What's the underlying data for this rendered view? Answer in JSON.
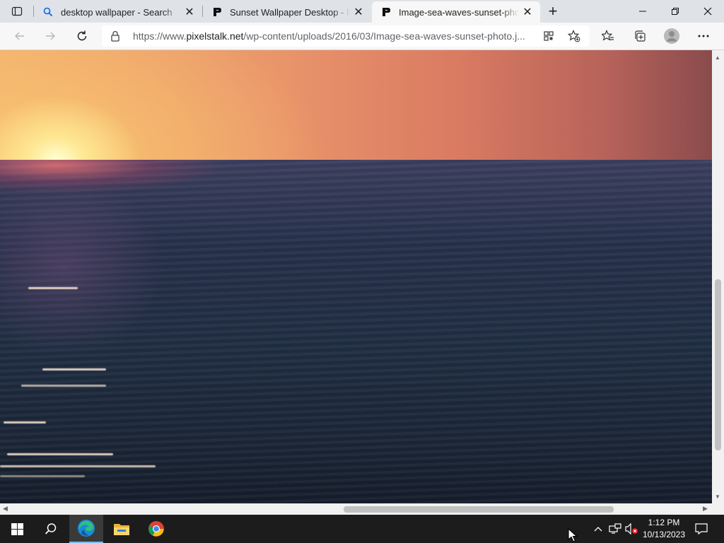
{
  "browser": {
    "tabs": [
      {
        "title": "desktop wallpaper - Search",
        "favicon": "search-icon",
        "active": false
      },
      {
        "title": "Sunset Wallpaper Desktop - Pixe",
        "favicon": "pixelstalk-icon",
        "active": false
      },
      {
        "title": "Image-sea-waves-sunset-photo.j",
        "favicon": "pixelstalk-icon",
        "active": true
      }
    ],
    "new_tab_label": "+",
    "address": {
      "url_prefix": "https://www.",
      "url_domain": "pixelstalk.net",
      "url_path": "/wp-content/uploads/2016/03/Image-sea-waves-sunset-photo.j..."
    }
  },
  "content": {
    "image_subject": "sea waves at sunset"
  },
  "colors": {
    "tabbar_bg": "#dfe3e8",
    "toolbar_bg": "#f7f7f7",
    "taskbar_bg": "#1c1c1c",
    "taskbar_active_accent": "#76b9ed"
  },
  "taskbar": {
    "apps": [
      "start-icon",
      "search-icon",
      "edge-icon",
      "file-explorer-icon",
      "chrome-icon"
    ],
    "clock": {
      "time": "1:12 PM",
      "date": "10/13/2023"
    }
  }
}
